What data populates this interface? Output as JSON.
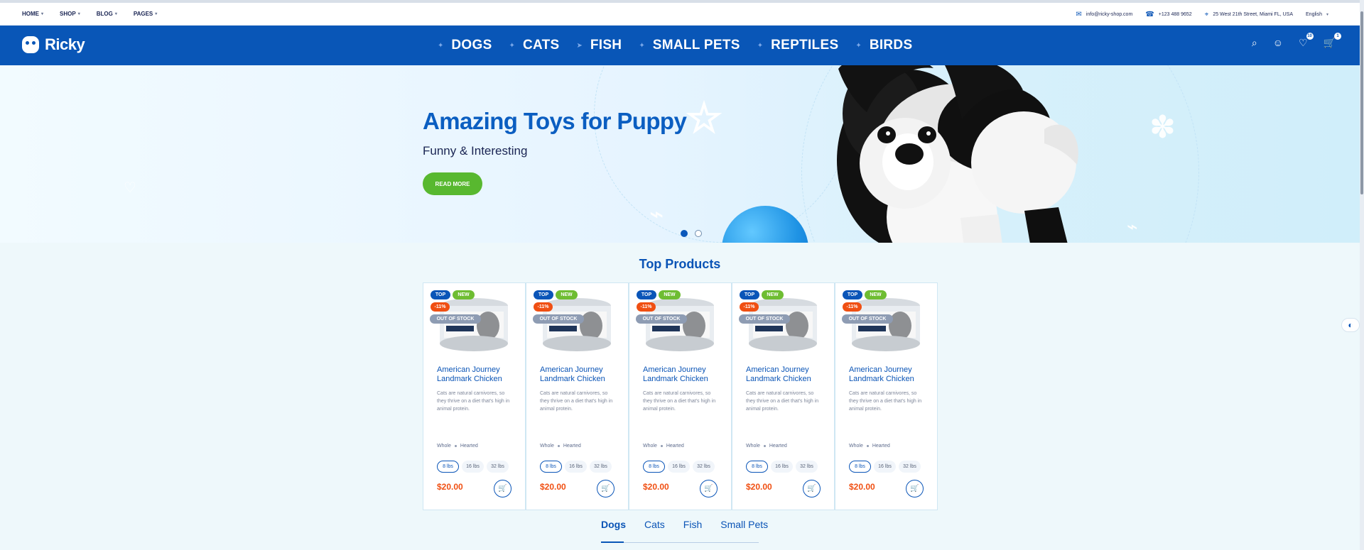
{
  "top_nav": [
    {
      "label": "HOME"
    },
    {
      "label": "SHOP"
    },
    {
      "label": "BLOG"
    },
    {
      "label": "PAGES"
    }
  ],
  "contact": {
    "email": "info@ricky-shop.com",
    "phone": "+123 488 9652",
    "address": "25 West 21th Street, Miami FL, USA",
    "language": "English"
  },
  "brand": {
    "name": "Ricky",
    "colors": {
      "primary": "#0956B7",
      "accent": "#58B82F",
      "sale": "#F04F12"
    }
  },
  "categories": [
    {
      "label": "DOGS",
      "icon": "dog-icon"
    },
    {
      "label": "CATS",
      "icon": "cat-icon"
    },
    {
      "label": "FISH",
      "icon": "fish-icon"
    },
    {
      "label": "SMALL PETS",
      "icon": "small-pets-icon"
    },
    {
      "label": "REPTILES",
      "icon": "reptile-icon"
    },
    {
      "label": "BIRDS",
      "icon": "bird-icon"
    }
  ],
  "header_actions": {
    "wishlist_count": "10",
    "cart_count": "1"
  },
  "hero": {
    "title": "Amazing Toys for Puppy",
    "subtitle": "Funny & Interesting",
    "cta": "READ MORE"
  },
  "section": {
    "title": "Top Products"
  },
  "products": [
    {
      "top": "TOP",
      "new": "NEW",
      "sale": "-11%",
      "oos": "OUT OF STOCK",
      "name": "American Journey Landmark Chicken",
      "description": "Cats are natural carnivores, so they thrive on a diet that's high in animal protein.",
      "type1": "Whole",
      "type2": "Hearted",
      "weights": [
        "8 lbs",
        "16 lbs",
        "32 lbs"
      ],
      "price": "$20.00"
    },
    {
      "top": "TOP",
      "new": "NEW",
      "sale": "-11%",
      "oos": "OUT OF STOCK",
      "name": "American Journey Landmark Chicken",
      "description": "Cats are natural carnivores, so they thrive on a diet that's high in animal protein.",
      "type1": "Whole",
      "type2": "Hearted",
      "weights": [
        "8 lbs",
        "16 lbs",
        "32 lbs"
      ],
      "price": "$20.00"
    },
    {
      "top": "TOP",
      "new": "NEW",
      "sale": "-11%",
      "oos": "OUT OF STOCK",
      "name": "American Journey Landmark Chicken",
      "description": "Cats are natural carnivores, so they thrive on a diet that's high in animal protein.",
      "type1": "Whole",
      "type2": "Hearted",
      "weights": [
        "8 lbs",
        "16 lbs",
        "32 lbs"
      ],
      "price": "$20.00"
    },
    {
      "top": "TOP",
      "new": "NEW",
      "sale": "-11%",
      "oos": "OUT OF STOCK",
      "name": "American Journey Landmark Chicken",
      "description": "Cats are natural carnivores, so they thrive on a diet that's high in animal protein.",
      "type1": "Whole",
      "type2": "Hearted",
      "weights": [
        "8 lbs",
        "16 lbs",
        "32 lbs"
      ],
      "price": "$20.00"
    },
    {
      "top": "TOP",
      "new": "NEW",
      "sale": "-11%",
      "oos": "OUT OF STOCK",
      "name": "American Journey Landmark Chicken",
      "description": "Cats are natural carnivores, so they thrive on a diet that's high in animal protein.",
      "type1": "Whole",
      "type2": "Hearted",
      "weights": [
        "8 lbs",
        "16 lbs",
        "32 lbs"
      ],
      "price": "$20.00"
    }
  ],
  "tabs": [
    {
      "label": "Dogs"
    },
    {
      "label": "Cats"
    },
    {
      "label": "Fish"
    },
    {
      "label": "Small Pets"
    }
  ]
}
